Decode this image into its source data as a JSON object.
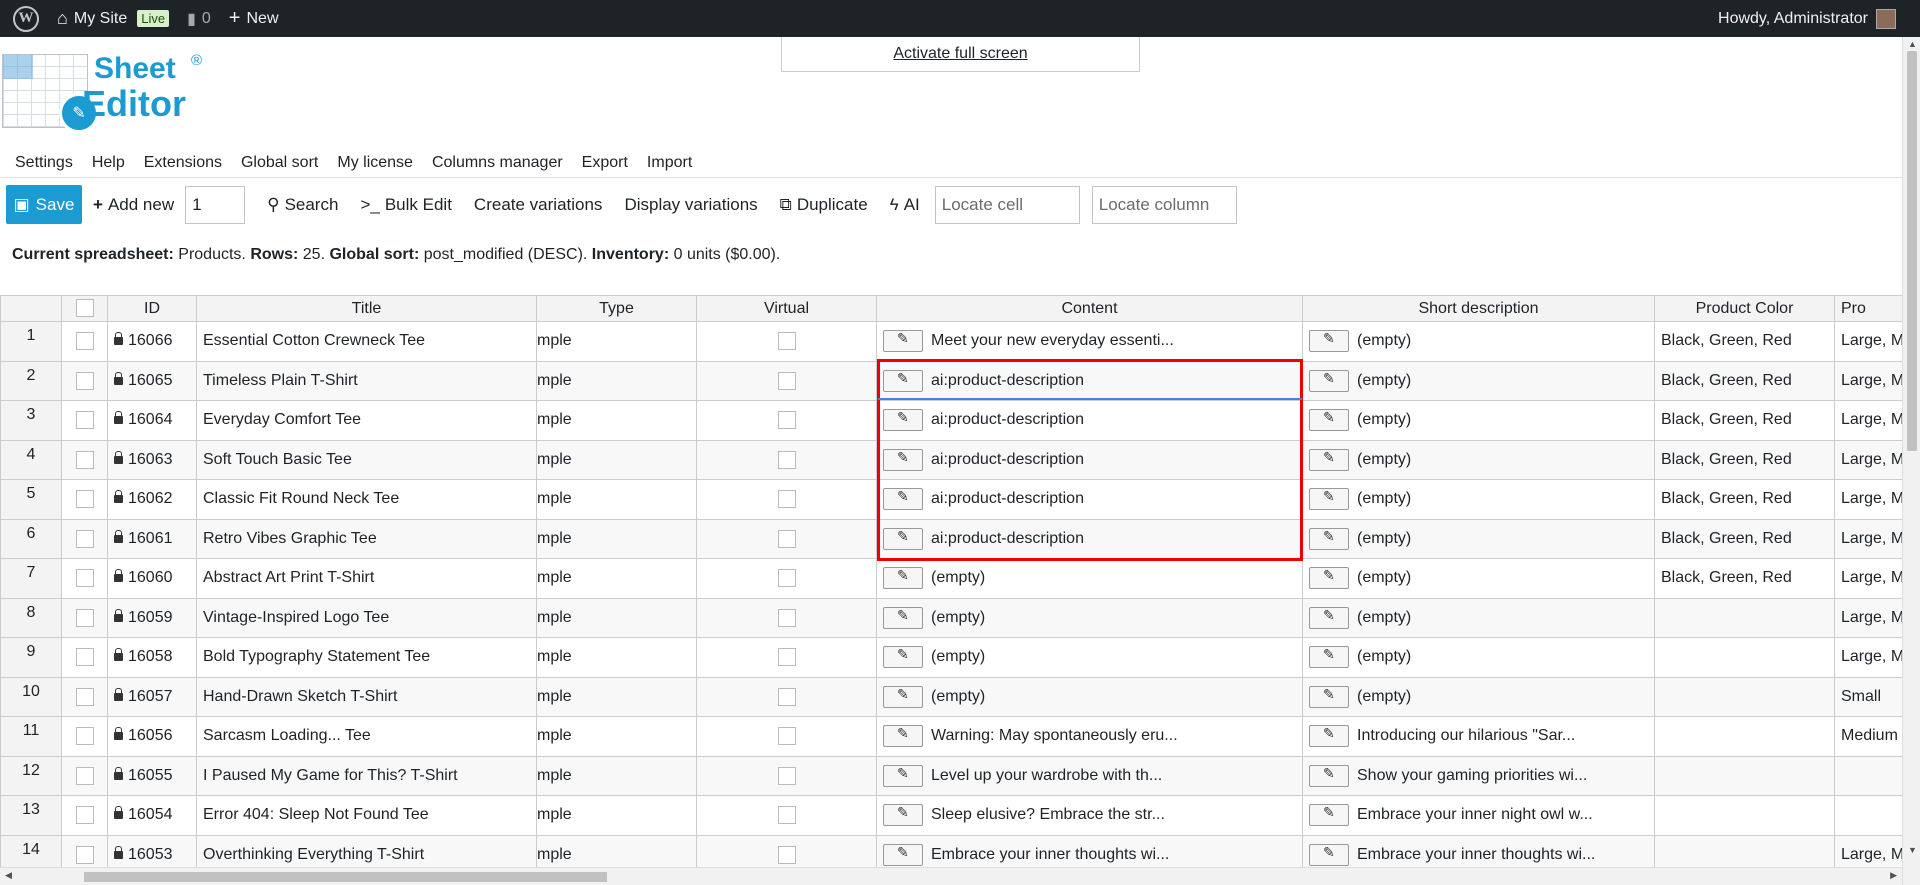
{
  "adminbar": {
    "site_name": "My Site",
    "live_badge": "Live",
    "comments_count": "0",
    "new_label": "New",
    "greeting": "Howdy, Administrator"
  },
  "fullscreen_link": "Activate full screen",
  "logo": {
    "line1": "Sheet",
    "line2": "Editor",
    "reg": "®"
  },
  "menu": [
    "Settings",
    "Help",
    "Extensions",
    "Global sort",
    "My license",
    "Columns manager",
    "Export",
    "Import"
  ],
  "toolbar": {
    "save": "Save",
    "add_new": "Add new",
    "add_new_count": "1",
    "search": "Search",
    "bulk_edit": "Bulk Edit",
    "create_variations": "Create variations",
    "display_variations": "Display variations",
    "duplicate": "Duplicate",
    "ai": "AI",
    "locate_cell_placeholder": "Locate cell",
    "locate_column_placeholder": "Locate column"
  },
  "status": {
    "spreadsheet_label": "Current spreadsheet:",
    "spreadsheet_value": "Products.",
    "rows_label": "Rows:",
    "rows_value": "25.",
    "sort_label": "Global sort:",
    "sort_value": "post_modified (DESC).",
    "inventory_label": "Inventory:",
    "inventory_value": "0 units ($0.00)."
  },
  "table": {
    "columns": [
      "ID",
      "Title",
      "Type",
      "Virtual",
      "Content",
      "Short description",
      "Product Color",
      "Pro"
    ],
    "rows": [
      {
        "n": "1",
        "id": "16066",
        "title": "Essential Cotton Crewneck Tee",
        "type": "mple",
        "content": "Meet your new everyday essenti...",
        "short": "(empty)",
        "color": "Black, Green, Red",
        "size": "Large, M"
      },
      {
        "n": "2",
        "id": "16065",
        "title": "Timeless Plain T-Shirt",
        "type": "mple",
        "content": "ai:product-description",
        "short": "(empty)",
        "color": "Black, Green, Red",
        "size": "Large, M"
      },
      {
        "n": "3",
        "id": "16064",
        "title": "Everyday Comfort Tee",
        "type": "mple",
        "content": "ai:product-description",
        "short": "(empty)",
        "color": "Black, Green, Red",
        "size": "Large, M"
      },
      {
        "n": "4",
        "id": "16063",
        "title": "Soft Touch Basic Tee",
        "type": "mple",
        "content": "ai:product-description",
        "short": "(empty)",
        "color": "Black, Green, Red",
        "size": "Large, M"
      },
      {
        "n": "5",
        "id": "16062",
        "title": "Classic Fit Round Neck Tee",
        "type": "mple",
        "content": "ai:product-description",
        "short": "(empty)",
        "color": "Black, Green, Red",
        "size": "Large, M"
      },
      {
        "n": "6",
        "id": "16061",
        "title": "Retro Vibes Graphic Tee",
        "type": "mple",
        "content": "ai:product-description",
        "short": "(empty)",
        "color": "Black, Green, Red",
        "size": "Large, M"
      },
      {
        "n": "7",
        "id": "16060",
        "title": "Abstract Art Print T-Shirt",
        "type": "mple",
        "content": "(empty)",
        "short": "(empty)",
        "color": "Black, Green, Red",
        "size": "Large, M"
      },
      {
        "n": "8",
        "id": "16059",
        "title": "Vintage-Inspired Logo Tee",
        "type": "mple",
        "content": "(empty)",
        "short": "(empty)",
        "color": "",
        "size": "Large, M"
      },
      {
        "n": "9",
        "id": "16058",
        "title": "Bold Typography Statement Tee",
        "type": "mple",
        "content": "(empty)",
        "short": "(empty)",
        "color": "",
        "size": "Large, M"
      },
      {
        "n": "10",
        "id": "16057",
        "title": "Hand-Drawn Sketch T-Shirt",
        "type": "mple",
        "content": "(empty)",
        "short": "(empty)",
        "color": "",
        "size": "Small"
      },
      {
        "n": "11",
        "id": "16056",
        "title": "Sarcasm Loading... Tee",
        "type": "mple",
        "content": "Warning: May spontaneously eru...",
        "short": "Introducing our hilarious \"Sar...",
        "color": "",
        "size": "Medium"
      },
      {
        "n": "12",
        "id": "16055",
        "title": "I Paused My Game for This? T-Shirt",
        "type": "mple",
        "content": "Level up your wardrobe with th...",
        "short": "Show your gaming priorities wi...",
        "color": "",
        "size": ""
      },
      {
        "n": "13",
        "id": "16054",
        "title": "Error 404: Sleep Not Found Tee",
        "type": "mple",
        "content": "Sleep elusive? Embrace the str...",
        "short": "Embrace your inner night owl w...",
        "color": "",
        "size": ""
      },
      {
        "n": "14",
        "id": "16053",
        "title": "Overthinking Everything T-Shirt",
        "type": "mple",
        "content": "Embrace your inner thoughts wi...",
        "short": "Embrace your inner thoughts wi...",
        "color": "",
        "size": "Large, M"
      }
    ]
  }
}
